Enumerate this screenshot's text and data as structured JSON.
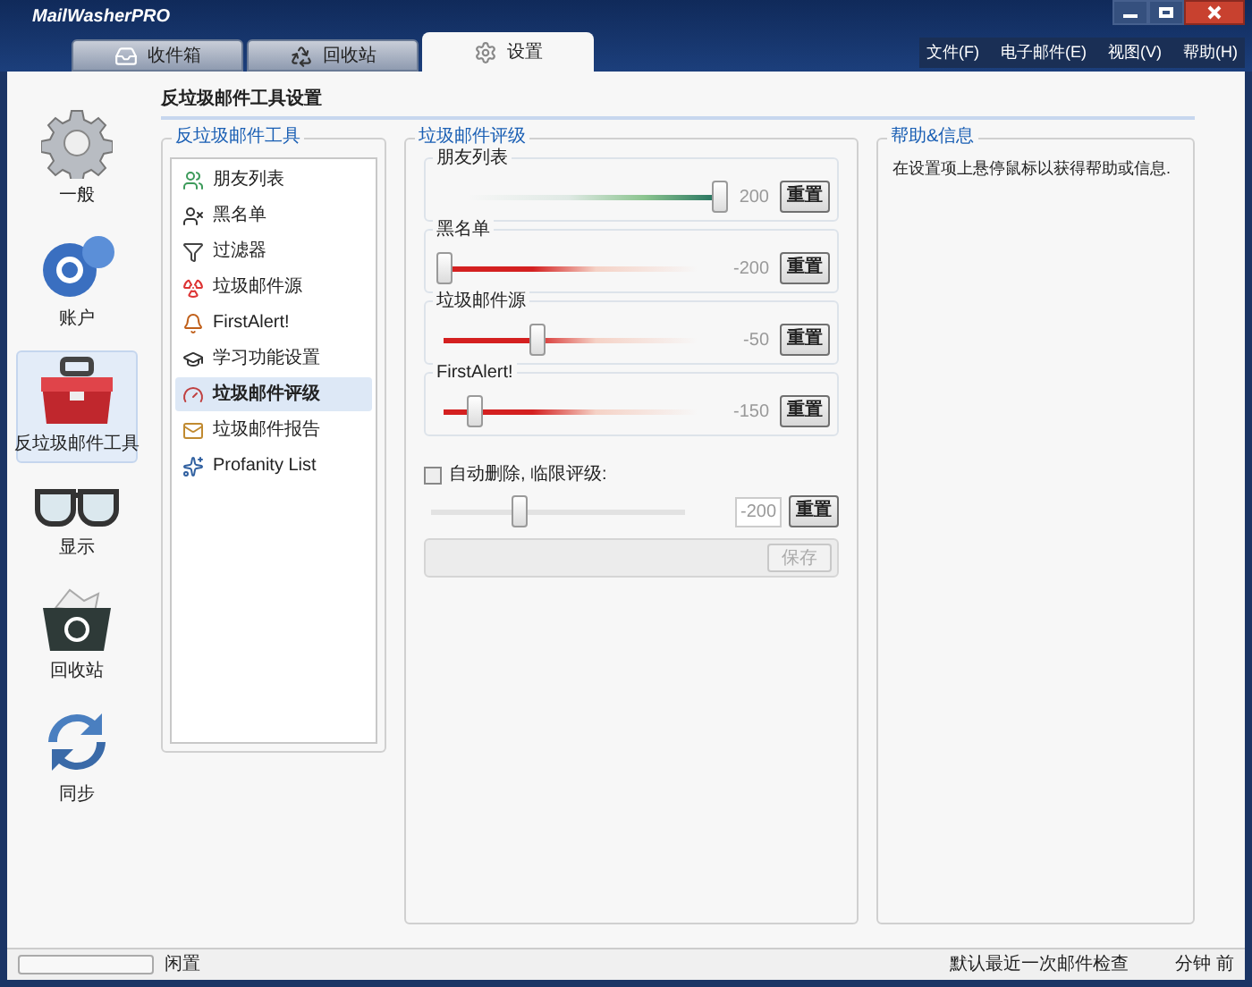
{
  "window": {
    "title": "MailWasherPRO"
  },
  "tabs": [
    {
      "label": "收件箱",
      "kind": "inbox",
      "selected": false
    },
    {
      "label": "回收站",
      "kind": "recycle",
      "selected": false
    },
    {
      "label": "设置",
      "kind": "gear",
      "selected": true
    }
  ],
  "menu": [
    "文件(F)",
    "电子邮件(E)",
    "视图(V)",
    "帮助(H)"
  ],
  "sidebar": {
    "items": [
      {
        "label": "一般",
        "kind": "gear",
        "selected": false
      },
      {
        "label": "账户",
        "kind": "account",
        "selected": false
      },
      {
        "label": "反垃圾邮件工具",
        "kind": "toolbox",
        "selected": true
      },
      {
        "label": "显示",
        "kind": "glasses",
        "selected": false
      },
      {
        "label": "回收站",
        "kind": "bin",
        "selected": false
      },
      {
        "label": "同步",
        "kind": "sync",
        "selected": false
      }
    ]
  },
  "page_title": "反垃圾邮件工具设置",
  "tools": {
    "title": "反垃圾邮件工具",
    "items": [
      {
        "label": "朋友列表",
        "kind": "friends",
        "selected": false
      },
      {
        "label": "黑名单",
        "kind": "blacklist",
        "selected": false
      },
      {
        "label": "过滤器",
        "kind": "filter",
        "selected": false
      },
      {
        "label": "垃圾邮件源",
        "kind": "source",
        "selected": false
      },
      {
        "label": "FirstAlert!",
        "kind": "alert",
        "selected": false
      },
      {
        "label": "学习功能设置",
        "kind": "learn",
        "selected": false
      },
      {
        "label": "垃圾邮件评级",
        "kind": "rating",
        "selected": true
      },
      {
        "label": "垃圾邮件报告",
        "kind": "report",
        "selected": false
      },
      {
        "label": "Profanity List",
        "kind": "profanity",
        "selected": false
      }
    ]
  },
  "rating": {
    "title": "垃圾邮件评级",
    "sliders": [
      {
        "label": "朋友列表",
        "kind": "trust",
        "level": 1,
        "reading": "200",
        "button": "重置"
      },
      {
        "label": "黑名单",
        "kind": "penalty",
        "level": 0,
        "reading": "-200",
        "button": "重置"
      },
      {
        "label": "垃圾邮件源",
        "kind": "penalty",
        "level": 0.37,
        "reading": "-50",
        "button": "重置"
      },
      {
        "label": "FirstAlert!",
        "kind": "penalty",
        "level": 0.12,
        "reading": "-150",
        "button": "重置"
      }
    ],
    "auto_delete": {
      "label": "自动删除, 临限评级:",
      "checked": false,
      "level": 0.35,
      "value": "-200",
      "button": "重置"
    },
    "save_button": {
      "label": "保存",
      "disabled": true
    }
  },
  "help": {
    "title": "帮助&信息",
    "text": "在设置项上悬停鼠标以获得帮助或信息."
  },
  "status_bar": {
    "level": 0,
    "status": "闲置",
    "last_check": "默认最近一次邮件检查",
    "last_check_tail": "分钟 前"
  }
}
